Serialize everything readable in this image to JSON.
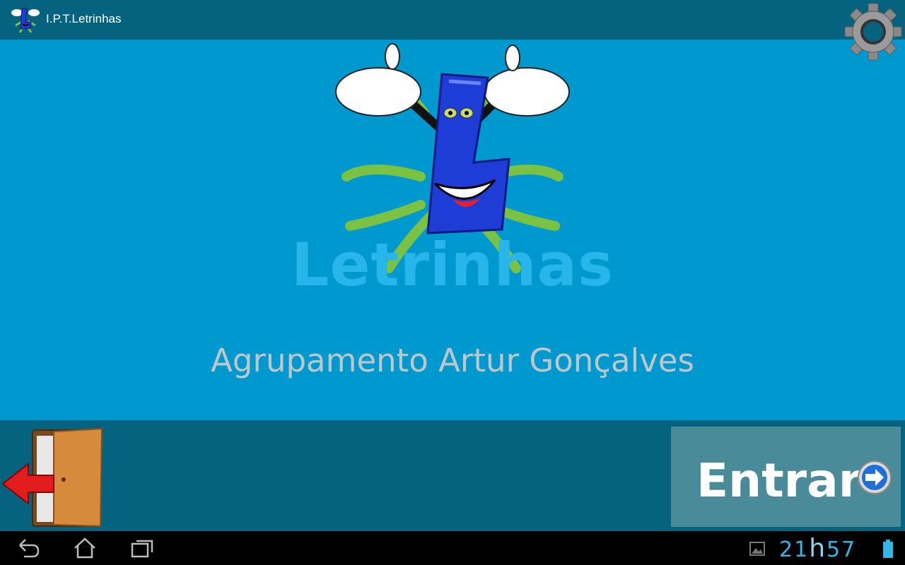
{
  "app": {
    "title": "I.P.T.Letrinhas"
  },
  "main": {
    "brand": "Letrinhas",
    "subtitle": "Agrupamento Artur Gonçalves"
  },
  "bottom": {
    "enter_label": "Entrar",
    "exit_icon": "door-exit-icon",
    "enter_icon": "arrow-right-circle-icon"
  },
  "status": {
    "clock_hours": "21",
    "clock_sep": "h",
    "clock_minutes": "57"
  },
  "colors": {
    "bar": "#066380",
    "main": "#0099cf",
    "brand": "#27b5ea",
    "enter_bg": "#4a8b9a",
    "clock": "#33b5e5"
  }
}
